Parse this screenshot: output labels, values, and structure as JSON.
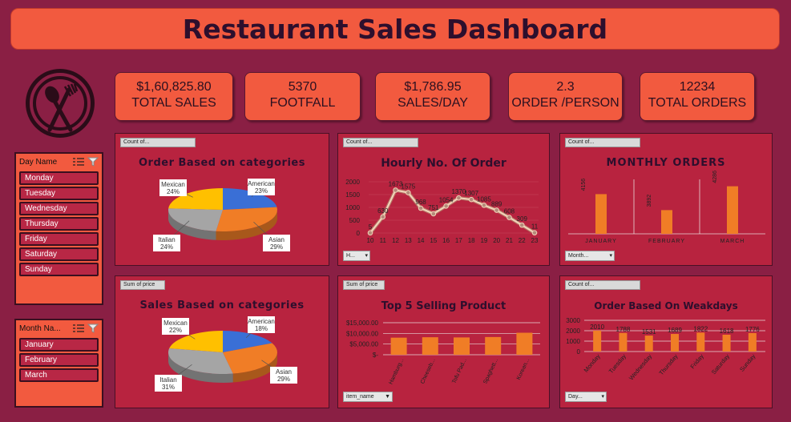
{
  "header": {
    "title": "Restaurant Sales Dashboard"
  },
  "logo": {
    "icon": "spoon-fork-icon"
  },
  "kpis": [
    {
      "value": "$1,60,825.80",
      "label": "TOTAL SALES"
    },
    {
      "value": "5370",
      "label": "FOOTFALL"
    },
    {
      "value": "$1,786.95",
      "label": "SALES/DAY"
    },
    {
      "value": "2.3",
      "label": "ORDER /PERSON"
    },
    {
      "value": "12234",
      "label": "TOTAL ORDERS"
    }
  ],
  "slicer_day": {
    "title": "Day Name",
    "items": [
      "Monday",
      "Tuesday",
      "Wednesday",
      "Thursday",
      "Friday",
      "Saturday",
      "Sunday"
    ]
  },
  "slicer_month": {
    "title": "Month Na...",
    "items": [
      "January",
      "February",
      "March"
    ]
  },
  "panels": {
    "cat_orders": {
      "tag": "Count of...",
      "title": "Order Based on categories"
    },
    "hourly": {
      "tag": "Count of...",
      "title": "Hourly No. Of  Order",
      "filter": "H..."
    },
    "monthly": {
      "tag": "Count of...",
      "title": "MONTHLY ORDERS",
      "filter": "Month..."
    },
    "cat_sales": {
      "tag": "Sum of price",
      "title": "Sales Based on categories"
    },
    "top5": {
      "tag": "Sum of price",
      "title": "Top 5 Selling Product",
      "filter": "item_name"
    },
    "weekday": {
      "tag": "Count of...",
      "title": "Order Based On Weakdays",
      "filter": "Day..."
    }
  },
  "colors": {
    "background": "#8a1f44",
    "accent": "#f25a3f",
    "panel": "#b8233f"
  },
  "chart_data": [
    {
      "id": "cat_orders",
      "type": "pie",
      "title": "Order Based on categories",
      "slices": [
        {
          "label": "American",
          "pct": "23%",
          "value": 23,
          "color": "#3a6fd6"
        },
        {
          "label": "Asian",
          "pct": "29%",
          "value": 29,
          "color": "#f07d26"
        },
        {
          "label": "Italian",
          "pct": "24%",
          "value": 24,
          "color": "#a5a5a5"
        },
        {
          "label": "Mexican",
          "pct": "24%",
          "value": 24,
          "color": "#ffc000"
        }
      ]
    },
    {
      "id": "hourly",
      "type": "line",
      "title": "Hourly No. Of  Order",
      "x": [
        10,
        11,
        12,
        13,
        14,
        15,
        16,
        17,
        18,
        19,
        20,
        21,
        22,
        23
      ],
      "values": [
        5,
        630,
        1673,
        1575,
        968,
        751,
        1054,
        1370,
        1307,
        1085,
        889,
        608,
        309,
        11
      ],
      "yticks": [
        0,
        500,
        1000,
        1500,
        2000
      ],
      "ylim": [
        0,
        2000
      ]
    },
    {
      "id": "monthly",
      "type": "bar",
      "title": "MONTHLY ORDERS",
      "categories": [
        "JANUARY",
        "FEBRUARY",
        "MARCH"
      ],
      "values": [
        4156,
        3892,
        4286
      ],
      "ylim": [
        3500,
        4400
      ]
    },
    {
      "id": "cat_sales",
      "type": "pie",
      "title": "Sales Based on categories",
      "slices": [
        {
          "label": "American",
          "pct": "18%",
          "value": 18,
          "color": "#3a6fd6"
        },
        {
          "label": "Asian",
          "pct": "29%",
          "value": 29,
          "color": "#f07d26"
        },
        {
          "label": "Italian",
          "pct": "31%",
          "value": 31,
          "color": "#a5a5a5"
        },
        {
          "label": "Mexican",
          "pct": "22%",
          "value": 22,
          "color": "#ffc000"
        }
      ]
    },
    {
      "id": "top5",
      "type": "bar",
      "title": "Top 5 Selling Product",
      "categories": [
        "Hamburg...",
        "Cheeseb...",
        "Tofu Pad...",
        "Spaghett...",
        "Korean..."
      ],
      "values": [
        8000,
        8200,
        8100,
        8300,
        10300
      ],
      "yticks": [
        "$-",
        "$5,000.00",
        "$10,000.00",
        "$15,000.00"
      ],
      "ylim": [
        0,
        15000
      ]
    },
    {
      "id": "weekday",
      "type": "bar",
      "title": "Order Based On Weakdays",
      "categories": [
        "Monday",
        "Tuesday",
        "Wednesday",
        "Thursday",
        "Friday",
        "Saturday",
        "Sunday"
      ],
      "values": [
        2010,
        1788,
        1531,
        1689,
        1822,
        1618,
        1776
      ],
      "yticks": [
        0,
        1000,
        2000,
        3000
      ],
      "ylim": [
        0,
        3000
      ]
    }
  ]
}
